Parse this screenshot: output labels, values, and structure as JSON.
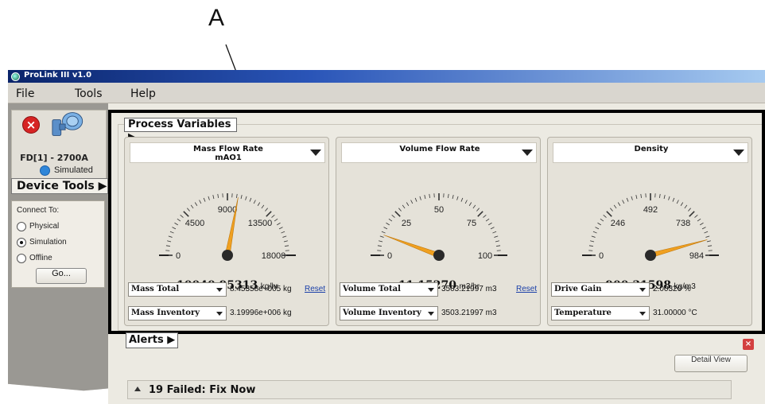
{
  "callout": {
    "letter": "A"
  },
  "app": {
    "title": "ProLink III v1.0"
  },
  "menu": {
    "items": [
      "File",
      "Tools",
      "Help"
    ]
  },
  "device": {
    "name": "FD[1] - 2700A",
    "status": "Simulated",
    "tools_label": "Device Tools ▶"
  },
  "connect": {
    "label": "Connect To:",
    "options": [
      {
        "label": "Physical",
        "selected": false
      },
      {
        "label": "Simulation",
        "selected": true
      },
      {
        "label": "Offline",
        "selected": false
      }
    ],
    "go_label": "Go..."
  },
  "process_variables": {
    "tab_label": "Process Variables ▶",
    "cards": [
      {
        "title": "Mass Flow Rate",
        "subtitle": "mAO1",
        "gauge": {
          "min": "0",
          "q1": "4500",
          "mid": "9000",
          "q3": "13500",
          "max": "18000",
          "fraction": 0.558,
          "pointer_color": "#f0a020"
        },
        "value": "10040.95313",
        "unit": "kg/hr",
        "rows": [
          {
            "label": "Mass Total",
            "value": "8.45358e+005 kg",
            "action": "Reset"
          },
          {
            "label": "Mass Inventory",
            "value": "3.19996e+006 kg",
            "action": ""
          }
        ]
      },
      {
        "title": "Volume Flow Rate",
        "subtitle": "",
        "gauge": {
          "min": "0",
          "q1": "25",
          "mid": "50",
          "q3": "75",
          "max": "100",
          "fraction": 0.112,
          "pointer_color": "#f0a020"
        },
        "value": "11.15270",
        "unit": "m3/hr",
        "rows": [
          {
            "label": "Volume Total",
            "value": "3503.21997 m3",
            "action": "Reset"
          },
          {
            "label": "Volume Inventory",
            "value": "3503.21997 m3",
            "action": ""
          }
        ]
      },
      {
        "title": "Density",
        "subtitle": "",
        "gauge": {
          "min": "0",
          "q1": "246",
          "mid": "492",
          "q3": "738",
          "max": "984",
          "fraction": 0.915,
          "pointer_color": "#f0a020"
        },
        "value": "900.31598",
        "unit": "kg/m3",
        "rows": [
          {
            "label": "Drive Gain",
            "value": "2.00320 %",
            "action": ""
          },
          {
            "label": "Temperature",
            "value": "31.00000 °C",
            "action": ""
          }
        ]
      }
    ]
  },
  "alerts": {
    "tab_label": "Alerts ▶",
    "detail_label": "Detail View",
    "close_label": "×",
    "summary": "19 Failed: Fix Now"
  }
}
